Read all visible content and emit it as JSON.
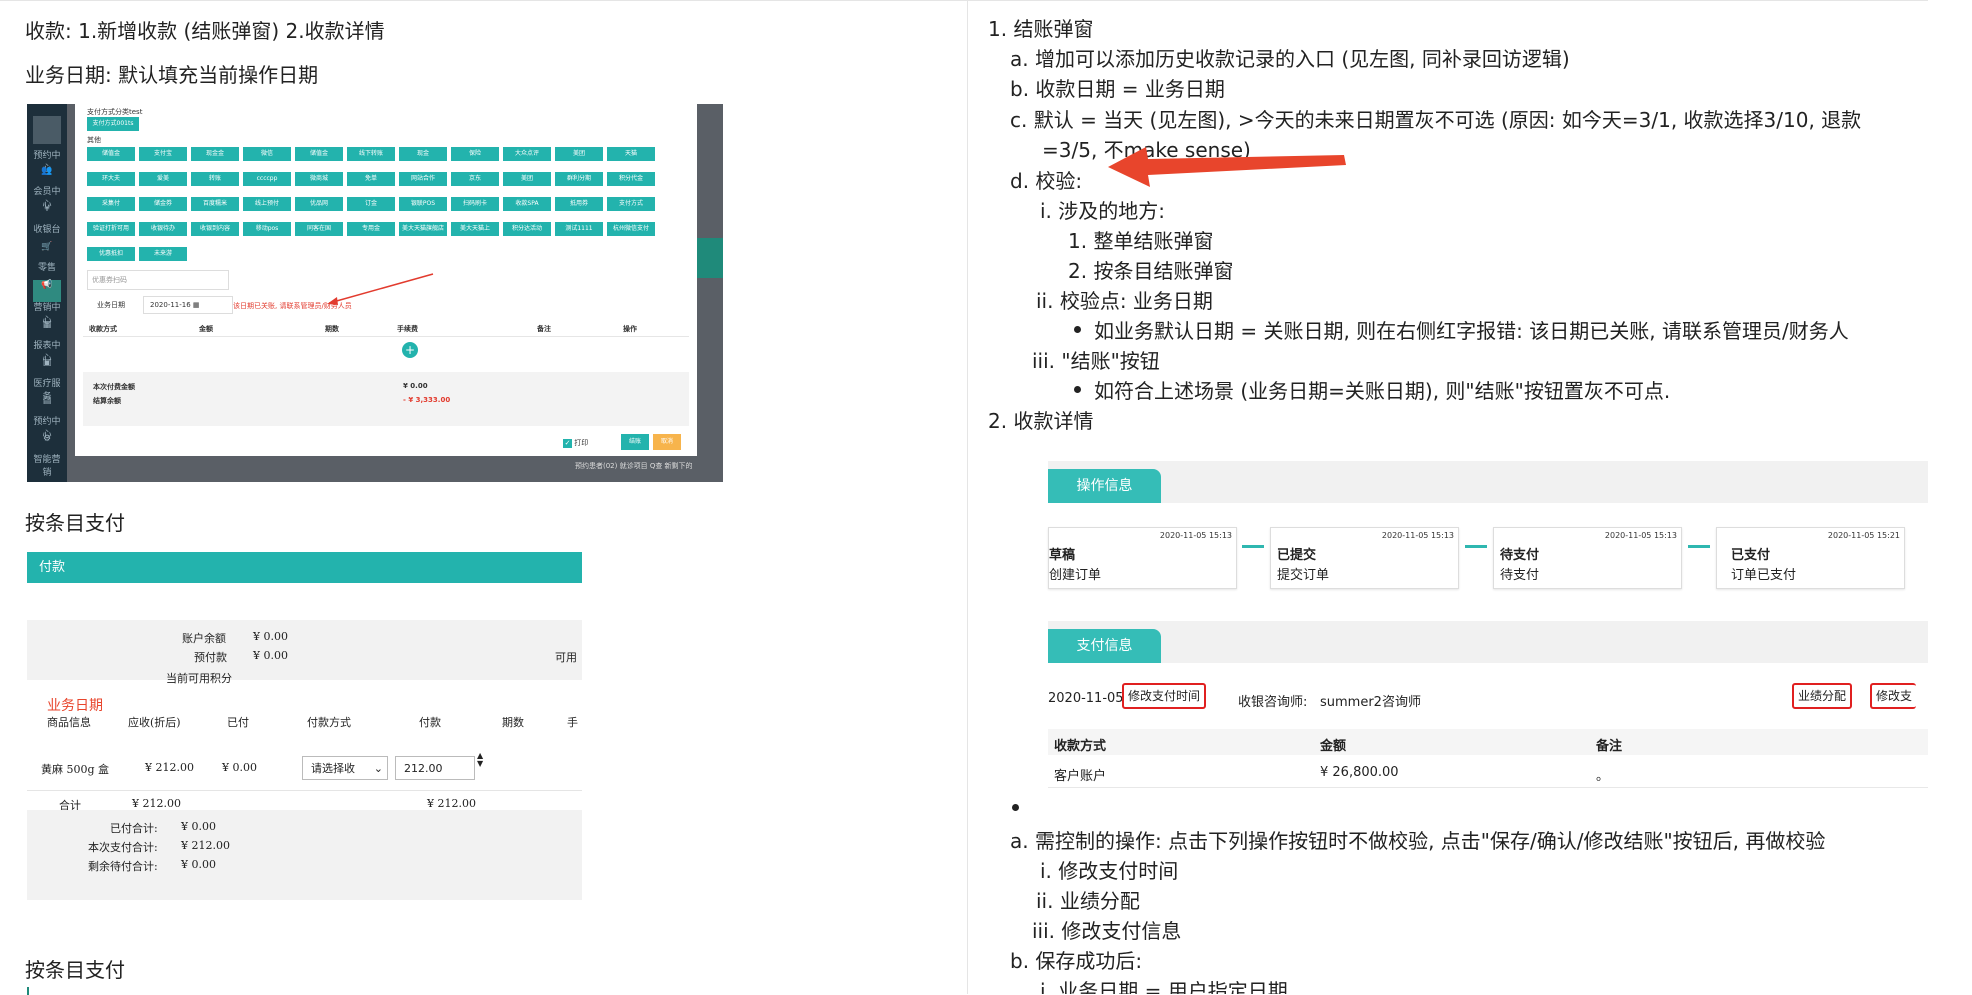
{
  "left": {
    "heading": "收款: 1.新增收款 (结账弹窗) 2.收款详情",
    "business_date_line": "业务日期: 默认填充当前操作日期",
    "shot1": {
      "pay_category": "支付方式分类test",
      "pay_method_btn": "支付方式001ts",
      "other": "其他",
      "buttons": [
        "储值金",
        "支付宝",
        "现金金",
        "微信",
        "储值金",
        "线下转账",
        "现金",
        "保险",
        "大众点评",
        "美团",
        "天猫",
        "环大夫",
        "爱美",
        "转账",
        "ccccpp",
        "微商城",
        "免单",
        "网站合作",
        "京东",
        "美团",
        "群利分期",
        "积分代金",
        "采集付",
        "储金券",
        "百度糯米",
        "线上预付",
        "优品网",
        "订金",
        "银联POS",
        "扫码刷卡",
        "收款SPA",
        "抵用券",
        "支付方式",
        "验证打折可用",
        "收银待办",
        "收银到内容",
        "移动pos",
        "同客在国",
        "专用金",
        "美大天猫旗舰店",
        "美大天猫上",
        "积分达活动",
        "测试1111",
        "杭州微信支付",
        "优惠抵扣",
        "未来游"
      ],
      "coupon_placeholder": "优惠券扫码",
      "business_date_label": "业务日期",
      "business_date_value": "2020-11-16",
      "error_text": "该日期已关账, 请联系管理员/财务人员",
      "col_method": "收款方式",
      "col_amount": "金额",
      "col_period": "期数",
      "col_fee": "手续费",
      "col_remark": "备注",
      "col_action": "操作",
      "total_label": "本次付费金额",
      "total_value": "¥ 0.00",
      "balance_label": "结算余额",
      "balance_value": "- ¥ 3,333.00",
      "print_label": "打印",
      "confirm_label": "结账",
      "cancel_label": "取消",
      "sidebar": [
        "预约中心",
        "会员中心",
        "收银台",
        "零售",
        "营销中心",
        "报表中心",
        "医疗服务",
        "预约中心",
        "智能营销"
      ],
      "bottom_note": "预约患者(02) 就诊项目    Q查 新剩下的"
    },
    "section_title_1": "按条目支付",
    "shot2": {
      "bar_title": "付款",
      "account_balance_label": "账户余额",
      "account_balance_value": "¥ 0.00",
      "prepaid_label": "预付款",
      "prepaid_value": "¥ 0.00",
      "available_label": "可用",
      "points_label": "当前可用积分",
      "business_date_red": "业务日期",
      "headers": [
        "商品信息",
        "应收(折后)",
        "已付",
        "付款方式",
        "付款",
        "期数",
        "手"
      ],
      "row_item": "黄麻 500g 盒",
      "row_receivable": "¥ 212.00",
      "row_paid": "¥ 0.00",
      "row_select": "请选择收",
      "row_pay": "212.00",
      "total_label": "合计",
      "total_receivable": "¥ 212.00",
      "total_pay": "¥ 212.00",
      "paid_total_label": "已付合计:",
      "paid_total_value": "¥ 0.00",
      "this_pay_label": "本次支付合计:",
      "this_pay_value": "¥ 212.00",
      "remain_label": "剩余待付合计:",
      "remain_value": "¥ 0.00"
    },
    "section_title_2": "按条目支付"
  },
  "right": {
    "l1": "1.  结账弹窗",
    "l1a": "a.  增加可以添加历史收款记录的入口 (见左图, 同补录回访逻辑)",
    "l1b": "b.  收款日期 = 业务日期",
    "l1c1": "c.  默认 = 当天 (见左图), >今天的未来日期置灰不可选 (原因: 如今天=3/1, 收款选择3/10, 退款",
    "l1c2": "=3/5, 不make sense)",
    "l1d": "d.  校验:",
    "l1d_i": "i.  涉及的地方:",
    "l1d_i1": "1.  整单结账弹窗",
    "l1d_i2": "2.  按条目结账弹窗",
    "l1d_ii": "ii.  校验点: 业务日期",
    "l1d_ii_b": "如业务默认日期 = 关账日期, 则在右侧红字报错: 该日期已关账, 请联系管理员/财务人",
    "l1d_iii": "iii.  \"结账\"按钮",
    "l1d_iii_b": "如符合上述场景 (业务日期=关账日期), 则\"结账\"按钮置灰不可点.",
    "l2": "2.  收款详情",
    "shot3": {
      "tab1": "操作信息",
      "cards": [
        {
          "status": "草稿",
          "desc": "创建订单",
          "time": "2020-11-05 15:13"
        },
        {
          "status": "已提交",
          "desc": "提交订单",
          "time": "2020-11-05 15:13"
        },
        {
          "status": "待支付",
          "desc": "待支付",
          "time": "2020-11-05 15:13"
        },
        {
          "status": "已支付",
          "desc": "订单已支付",
          "time": "2020-11-05 15:21"
        }
      ],
      "tab2": "支付信息",
      "pay_date": "2020-11-05",
      "modify_time_btn": "修改支付时间",
      "cashier_label": "收银咨询师:",
      "cashier_value": "summer2咨询师",
      "perf_btn": "业绩分配",
      "modify_pay_btn": "修改支",
      "col_method": "收款方式",
      "col_amount": "金额",
      "col_remark": "备注",
      "row_method": "客户账户",
      "row_amount": "¥ 26,800.00",
      "row_remark": "。"
    },
    "l2a": "a.  需控制的操作: 点击下列操作按钮时不做校验, 点击\"保存/确认/修改结账\"按钮后, 再做校验",
    "l2a_i": "i.  修改支付时间",
    "l2a_ii": "ii.  业绩分配",
    "l2a_iii": "iii.  修改支付信息",
    "l2b": "b.  保存成功后:",
    "l2b_i": "i.  业务日期 = 用户指定日期"
  },
  "colors": {
    "teal": "#23b3ad",
    "red_arrow": "#e8452c",
    "error_red": "#e23b2e"
  }
}
